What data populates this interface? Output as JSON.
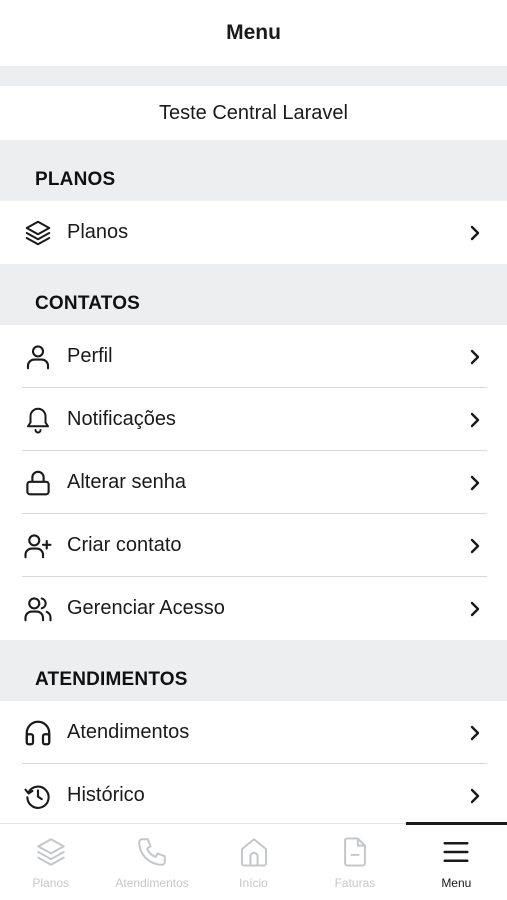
{
  "header": {
    "title": "Menu"
  },
  "account": {
    "name": "Teste Central Laravel"
  },
  "sections": {
    "planos": {
      "title": "PLANOS",
      "items": [
        {
          "label": "Planos",
          "icon": "layers-icon"
        }
      ]
    },
    "contatos": {
      "title": "CONTATOS",
      "items": [
        {
          "label": "Perfil",
          "icon": "user-icon"
        },
        {
          "label": "Notificações",
          "icon": "bell-icon"
        },
        {
          "label": "Alterar senha",
          "icon": "lock-icon"
        },
        {
          "label": "Criar contato",
          "icon": "user-plus-icon"
        },
        {
          "label": "Gerenciar Acesso",
          "icon": "users-icon"
        }
      ]
    },
    "atendimentos": {
      "title": "ATENDIMENTOS",
      "items": [
        {
          "label": "Atendimentos",
          "icon": "headphones-icon"
        },
        {
          "label": "Histórico",
          "icon": "history-icon"
        }
      ]
    }
  },
  "bottom_nav": {
    "items": [
      {
        "label": "Planos",
        "icon": "layers-icon"
      },
      {
        "label": "Atendimentos",
        "icon": "phone-icon"
      },
      {
        "label": "Início",
        "icon": "home-icon"
      },
      {
        "label": "Faturas",
        "icon": "document-icon"
      },
      {
        "label": "Menu",
        "icon": "hamburger-menu-icon"
      }
    ],
    "active": "Menu"
  },
  "colors": {
    "text": "#1a1a1a",
    "section_bg": "#eceef0",
    "divider": "#d6d8db",
    "nav_inactive": "#c4c7ca"
  }
}
